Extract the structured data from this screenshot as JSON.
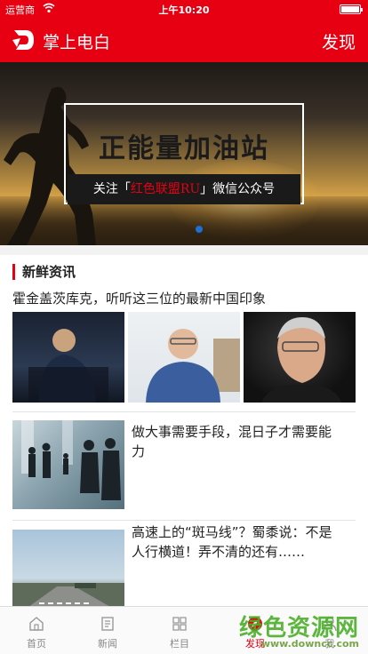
{
  "status_bar": {
    "carrier": "运营商",
    "time": "上午10:20",
    "battery_level": 1.0
  },
  "nav": {
    "title": "掌上电白",
    "action": "发现"
  },
  "banner": {
    "headline": "正能量加油站",
    "sub_prefix": "关注「",
    "sub_highlight": "红色联盟RU",
    "sub_suffix": "」微信公众号",
    "page_index": 1
  },
  "section": {
    "title": "新鲜资讯"
  },
  "news": [
    {
      "title": "霍金盖茨库克，听听这三位的最新中国印象"
    },
    {
      "title": "做大事需要手段，混日子才需要能力"
    },
    {
      "title": "高速上的“斑马线”？蜀黍说：不是人行横道！弄不清的还有……"
    }
  ],
  "tabs": [
    {
      "label": "首页",
      "icon": "home-icon"
    },
    {
      "label": "新闻",
      "icon": "news-icon"
    },
    {
      "label": "栏目",
      "icon": "grid-icon"
    },
    {
      "label": "发现",
      "icon": "compass-icon",
      "active": true
    },
    {
      "label": "我",
      "icon": "user-icon"
    }
  ],
  "watermark": {
    "text": "绿色资源网",
    "url": "www.downcc.com"
  },
  "colors": {
    "brand_red": "#e60012",
    "indicator_blue": "#1e6fd6"
  }
}
